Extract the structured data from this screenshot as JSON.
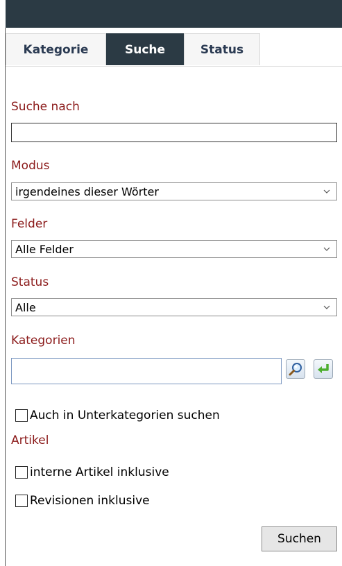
{
  "tabs": [
    {
      "label": "Kategorie",
      "active": false
    },
    {
      "label": "Suche",
      "active": true
    },
    {
      "label": "Status",
      "active": false
    }
  ],
  "search": {
    "label": "Suche nach",
    "value": "",
    "placeholder": ""
  },
  "mode": {
    "label": "Modus",
    "selected": "irgendeines dieser Wörter"
  },
  "fields": {
    "label": "Felder",
    "selected": "Alle Felder"
  },
  "status": {
    "label": "Status",
    "selected": "Alle"
  },
  "categories": {
    "label": "Kategorien",
    "value": "",
    "placeholder": "",
    "search_icon": "magnifier-icon",
    "apply_icon": "green-return-arrow-icon"
  },
  "subcategories": {
    "label": "Auch in Unterkategorien suchen",
    "checked": false
  },
  "articles": {
    "label": "Artikel",
    "internal": {
      "label": "interne Artikel inklusive",
      "checked": false
    },
    "revisions": {
      "label": "Revisionen inklusive",
      "checked": false
    }
  },
  "submit_label": "Suchen",
  "colors": {
    "header": "#2b3a44",
    "tab_text": "#2a3a52",
    "label": "#8b1a1a"
  }
}
